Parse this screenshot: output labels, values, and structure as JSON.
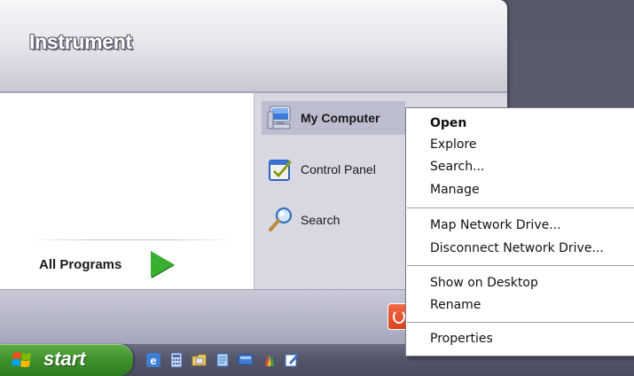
{
  "start_menu": {
    "user_name": "Instrument",
    "all_programs_label": "All Programs",
    "right_column": [
      {
        "label": "My Computer",
        "icon": "my-computer-icon",
        "bold": true
      },
      {
        "label": "Control Panel",
        "icon": "control-panel-icon",
        "bold": false
      },
      {
        "label": "Search",
        "icon": "search-icon",
        "bold": false
      }
    ]
  },
  "taskbar": {
    "start_label": "start",
    "quick_launch": [
      "ie-icon",
      "calculator-icon",
      "folder-icon",
      "notepad-icon",
      "remote-desktop-icon",
      "paint-icon",
      "wordpad-icon"
    ]
  },
  "context_menu": {
    "items": [
      {
        "label": "Open",
        "default": true
      },
      {
        "label": "Explore"
      },
      {
        "label": "Search..."
      },
      {
        "label": "Manage"
      },
      {
        "label": "Map Network Drive..."
      },
      {
        "label": "Disconnect Network Drive..."
      },
      {
        "label": "Show on Desktop"
      },
      {
        "label": "Rename"
      },
      {
        "label": "Properties"
      }
    ]
  },
  "colors": {
    "desktop": "#5d5f70",
    "start_button": "#3d8f2b",
    "highlight": "#bcbdcf"
  }
}
